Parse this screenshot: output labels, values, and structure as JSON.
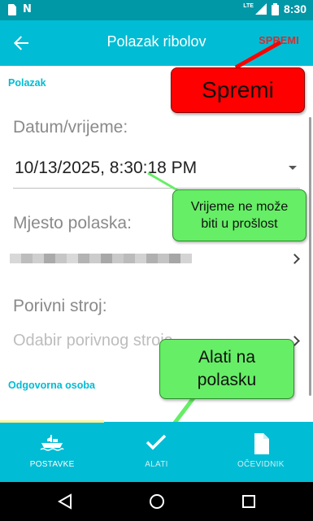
{
  "status_bar": {
    "network_label": "LTE",
    "time": "8:30",
    "left_icons": [
      "sim-card-icon",
      "n-notification-icon"
    ],
    "right_icons": [
      "signal-icon",
      "battery-icon"
    ]
  },
  "app_bar": {
    "title": "Polazak ribolov",
    "save_label": "SPREMI",
    "background_color": "#00bcd4",
    "save_color": "#d32f2f"
  },
  "form": {
    "section_departure": "Polazak",
    "datetime_label": "Datum/vrijeme:",
    "datetime_value": "10/13/2025, 8:30:18 PM",
    "place_label": "Mjesto polaska:",
    "motor_label": "Porivni stroj:",
    "motor_placeholder": "Odabir porivnog stroja",
    "section_responsible": "Odgovorna osoba",
    "accent_color": "#00bcd4"
  },
  "tooltips": {
    "save": "Spremi",
    "time_line1": "Vrijeme ne može",
    "time_line2": "biti u prošlost",
    "tools_line1": "Alati na",
    "tools_line2": "polasku"
  },
  "tabs": [
    {
      "label": "POSTAVKE",
      "icon": "boat-icon",
      "active": true
    },
    {
      "label": "ALATI",
      "icon": "checkmark-icon",
      "active": false
    },
    {
      "label": "OČEVIDNIK",
      "icon": "document-icon",
      "active": false
    }
  ],
  "nav_bar": {
    "buttons": [
      "back-triangle-icon",
      "home-circle-icon",
      "recents-square-icon"
    ]
  }
}
